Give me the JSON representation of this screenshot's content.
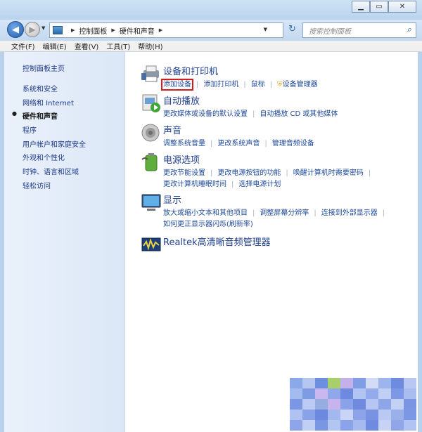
{
  "toolbar": {
    "breadcrumb": [
      "控制面板",
      "硬件和声音"
    ],
    "search_placeholder": "搜索控制面板"
  },
  "menu": [
    "文件(F)",
    "编辑(E)",
    "查看(V)",
    "工具(T)",
    "帮助(H)"
  ],
  "sidebar": {
    "home": "控制面板主页",
    "items": [
      "系统和安全",
      "网络和 Internet",
      "硬件和声音",
      "程序",
      "用户帐户和家庭安全",
      "外观和个性化",
      "时钟、语言和区域",
      "轻松访问"
    ],
    "current": "硬件和声音"
  },
  "sections": [
    {
      "icon": "printer-icon",
      "title": "设备和打印机",
      "links": [
        [
          "添加设备",
          "添加打印机",
          "鼠标",
          "设备管理器"
        ]
      ]
    },
    {
      "icon": "autoplay-icon",
      "title": "自动播放",
      "links": [
        [
          "更改媒体或设备的默认设置",
          "自动播放 CD 或其他媒体"
        ]
      ]
    },
    {
      "icon": "speaker-icon",
      "title": "声音",
      "links": [
        [
          "调整系统音量",
          "更改系统声音",
          "管理音频设备"
        ]
      ]
    },
    {
      "icon": "battery-icon",
      "title": "电源选项",
      "links": [
        [
          "更改节能设置",
          "更改电源按钮的功能",
          "唤醒计算机时需要密码"
        ],
        [
          "更改计算机睡眠时间",
          "选择电源计划"
        ]
      ]
    },
    {
      "icon": "monitor-icon",
      "title": "显示",
      "links": [
        [
          "放大或缩小文本和其他项目",
          "调整屏幕分辨率",
          "连接到外部显示器"
        ],
        [
          "如何更正显示器闪烁(刷新率)"
        ]
      ]
    },
    {
      "icon": "realtek-audio-icon",
      "title": "Realtek高清晰音频管理器",
      "links": []
    }
  ],
  "colors": {
    "link": "#1e4a9a",
    "title": "#1f3f8f",
    "highlight": "#d41c1c",
    "sidebar_bg": "#dbe7f6"
  }
}
